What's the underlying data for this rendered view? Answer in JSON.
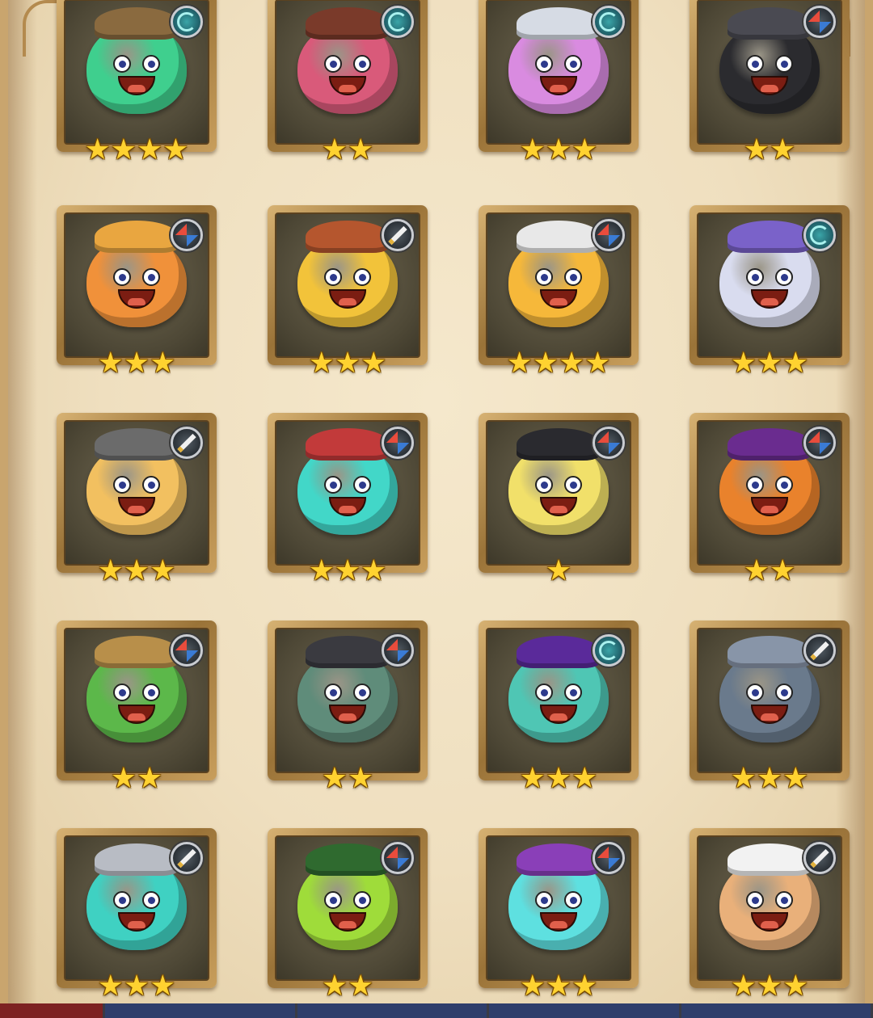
{
  "colors": {
    "parchment": "#efdfbf",
    "frame_gold": "#b58a48",
    "star": "#ffd230",
    "badge_ring": "#c9ccd1"
  },
  "heroes": [
    {
      "class_icon": "mage-swirl-icon",
      "stars": 4,
      "body": "#3fcf8e",
      "hat": "#8a6a3f"
    },
    {
      "class_icon": "mage-swirl-icon",
      "stars": 2,
      "body": "#d95a7a",
      "hat": "#7a3a2a"
    },
    {
      "class_icon": "mage-swirl-icon",
      "stars": 3,
      "body": "#d98be0",
      "hat": "#d6dbe4"
    },
    {
      "class_icon": "rogue-diamond-icon",
      "stars": 2,
      "body": "#2b2b2f",
      "hat": "#4a4a52"
    },
    {
      "class_icon": "rogue-diamond-icon",
      "stars": 3,
      "body": "#f0913a",
      "hat": "#e9a640"
    },
    {
      "class_icon": "warrior-sword-icon",
      "stars": 3,
      "body": "#f2c33a",
      "hat": "#b5562e"
    },
    {
      "class_icon": "rogue-diamond-icon",
      "stars": 4,
      "body": "#f6b83a",
      "hat": "#e8e8e8"
    },
    {
      "class_icon": "mage-swirl-icon",
      "stars": 3,
      "body": "#d9dcef",
      "hat": "#7a62c9"
    },
    {
      "class_icon": "warrior-sword-icon",
      "stars": 3,
      "body": "#f2c060",
      "hat": "#6b6b6b"
    },
    {
      "class_icon": "rogue-diamond-icon",
      "stars": 3,
      "body": "#42d7c8",
      "hat": "#c23a3a"
    },
    {
      "class_icon": "rogue-diamond-icon",
      "stars": 1,
      "body": "#f1e06a",
      "hat": "#2a2a2f"
    },
    {
      "class_icon": "rogue-diamond-icon",
      "stars": 2,
      "body": "#e9822c",
      "hat": "#6a2c8f"
    },
    {
      "class_icon": "rogue-diamond-icon",
      "stars": 2,
      "body": "#5cb84a",
      "hat": "#b88f4a"
    },
    {
      "class_icon": "rogue-diamond-icon",
      "stars": 2,
      "body": "#5f8c7a",
      "hat": "#3a3a40"
    },
    {
      "class_icon": "mage-swirl-icon",
      "stars": 3,
      "body": "#4fc6b4",
      "hat": "#5a2a9a"
    },
    {
      "class_icon": "warrior-sword-icon",
      "stars": 3,
      "body": "#6a7a8c",
      "hat": "#8895a8"
    },
    {
      "class_icon": "warrior-sword-icon",
      "stars": 3,
      "body": "#3fd1c2",
      "hat": "#b8bcc4"
    },
    {
      "class_icon": "rogue-diamond-icon",
      "stars": 2,
      "body": "#9fdc3a",
      "hat": "#2f6a2f"
    },
    {
      "class_icon": "rogue-diamond-icon",
      "stars": 3,
      "body": "#5ee0e0",
      "hat": "#8a3fb8"
    },
    {
      "class_icon": "warrior-sword-icon",
      "stars": 3,
      "body": "#e9b07a",
      "hat": "#f2f2f2"
    }
  ]
}
